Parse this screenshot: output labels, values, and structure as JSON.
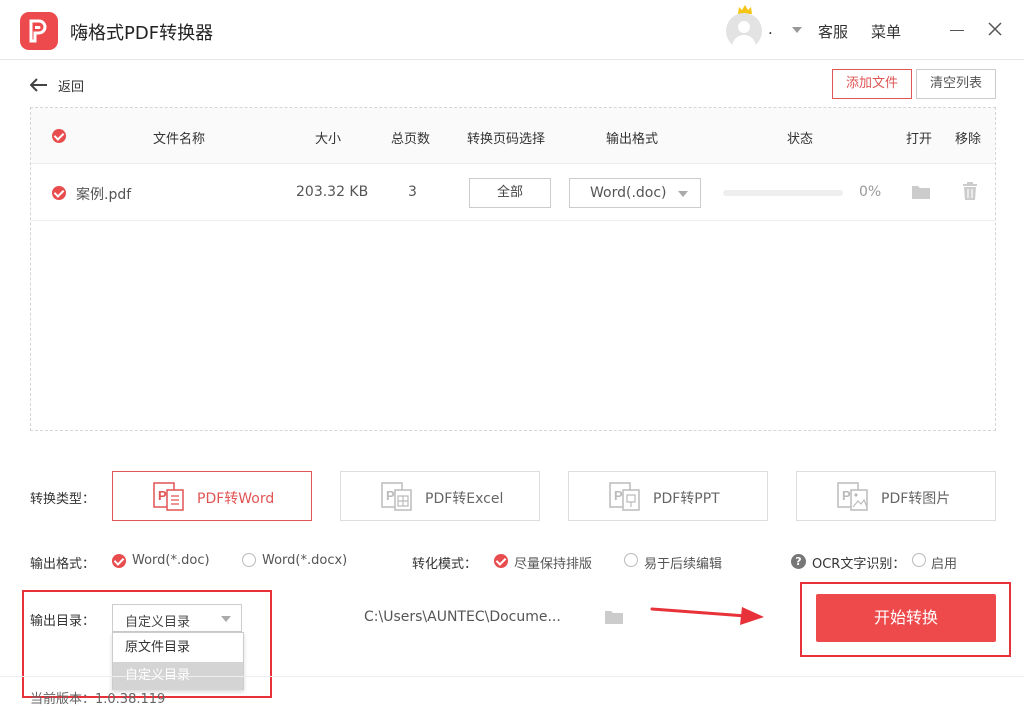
{
  "app": {
    "title": "嗨格式PDF转换器",
    "username": ".",
    "service": "客服",
    "menu": "菜单"
  },
  "colors": {
    "accent": "#e84c4d",
    "annotation": "#e8323a"
  },
  "toolbar": {
    "back": "返回",
    "add_files": "添加文件",
    "clear_list": "清空列表"
  },
  "table": {
    "headers": [
      "文件名称",
      "大小",
      "总页数",
      "转换页码选择",
      "输出格式",
      "状态",
      "打开",
      "移除"
    ],
    "rows": [
      {
        "name": "案例.pdf",
        "size": "203.32 KB",
        "pages": "3",
        "page_select": "全部",
        "format": "Word(.doc)",
        "progress": 0,
        "status": "0%"
      }
    ]
  },
  "conversion_types": {
    "label": "转换类型：",
    "items": [
      {
        "label": "PDF转Word",
        "active": true,
        "icon": "pdf-word-icon"
      },
      {
        "label": "PDF转Excel",
        "active": false,
        "icon": "pdf-excel-icon"
      },
      {
        "label": "PDF转PPT",
        "active": false,
        "icon": "pdf-ppt-icon"
      },
      {
        "label": "PDF转图片",
        "active": false,
        "icon": "pdf-image-icon"
      }
    ]
  },
  "output_format": {
    "label": "输出格式：",
    "options": [
      "Word(*.doc)",
      "Word(*.docx)"
    ],
    "selected": "Word(*.doc)"
  },
  "conversion_mode": {
    "label": "转化模式：",
    "options": [
      "尽量保持排版",
      "易于后续编辑"
    ],
    "selected": "尽量保持排版"
  },
  "ocr": {
    "label": "OCR文字识别：",
    "option": "启用",
    "help": "?"
  },
  "output_dir": {
    "label": "输出目录：",
    "selected": "自定义目录",
    "options": [
      "原文件目录",
      "自定义目录"
    ],
    "path": "C:\\Users\\AUNTEC\\Docume..."
  },
  "start_button": "开始转换",
  "version": "当前版本：1.0.38.119"
}
